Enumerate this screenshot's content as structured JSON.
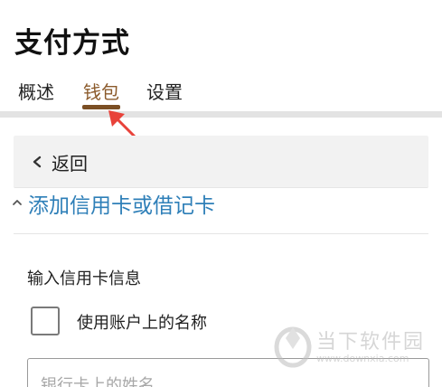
{
  "page": {
    "title": "支付方式"
  },
  "tabs": [
    {
      "label": "概述",
      "active": false
    },
    {
      "label": "钱包",
      "active": true
    },
    {
      "label": "设置",
      "active": false
    }
  ],
  "back": {
    "label": "返回",
    "icon": "chevron-left-icon"
  },
  "add_card": {
    "label": "添加信用卡或借记卡",
    "icon": "chevron-up-icon"
  },
  "form": {
    "heading": "输入信用卡信息",
    "use_account_name_label": "使用账户上的名称",
    "use_account_name_checked": false,
    "name_placeholder": "银行卡上的姓名",
    "name_value": ""
  },
  "watermark": {
    "text": "当下软件园",
    "url": "www.downxia.com"
  },
  "colors": {
    "active_tab": "#8b5a2b",
    "tab_underline": "#7b4f24",
    "link": "#2e7fb8",
    "annotation_arrow": "#e8423a"
  }
}
